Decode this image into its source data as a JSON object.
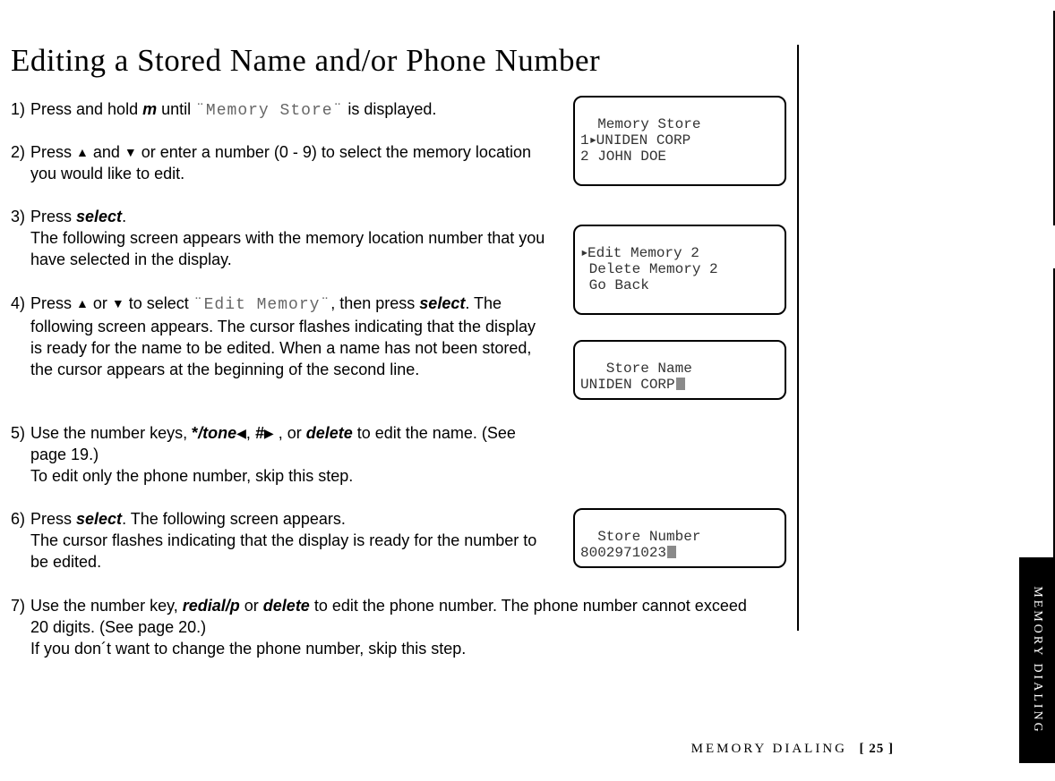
{
  "title": "Editing a Stored Name and/or Phone Number",
  "steps": {
    "s1_a": "Press and hold ",
    "s1_key": "m",
    "s1_b": " until ",
    "s1_lcd": "¨Memory Store¨",
    "s1_c": " is displayed.",
    "s2_a": "Press ",
    "s2_b": " and ",
    "s2_c": " or enter a number (0 - 9) to select the memory location you would like to edit.",
    "s3_a": "Press ",
    "s3_key": "select",
    "s3_b": ".",
    "s3_c": "The following screen appears with the memory location number that you have selected in the display.",
    "s4_a": "Press ",
    "s4_b": " or ",
    "s4_c": " to select ",
    "s4_lcd": "¨Edit Memory¨",
    "s4_d": ", then press ",
    "s4_key": "select",
    "s4_e": ". The following screen appears. The cursor flashes indicating that the display is ready for the name to be edited. When a name has not been stored, the cursor appears at the beginning of the second line.",
    "s5_a": "Use the number keys,  ",
    "s5_star": "*",
    "s5_tone": "/tone",
    "s5_b": ", ",
    "s5_hash": "#",
    "s5_c": " , or ",
    "s5_del": "delete",
    "s5_d": " to edit the name. (See page 19.)",
    "s5_e": "To edit only the phone number, skip this step.",
    "s6_a": "Press ",
    "s6_key": "select",
    "s6_b": ". The following screen appears.",
    "s6_c": "The cursor flashes indicating that the display is ready for the number to be edited.",
    "s7_a": "Use the number key, ",
    "s7_redial": "redial/p",
    "s7_b": " or ",
    "s7_del": "delete",
    "s7_c": " to edit the phone number. The phone number cannot exceed 20 digits. (See page 20.)",
    "s7_d": "If you don´t want to change the phone number, skip this step."
  },
  "lcd": {
    "box1_l1": "  Memory Store",
    "box1_l2": "1 UNIDEN CORP",
    "box1_l3": "2 JOHN DOE",
    "box2_l1": " Edit Memory 2",
    "box2_l2": " Delete Memory 2",
    "box2_l3": " Go Back",
    "box3_l1": "   Store Name",
    "box3_l2": "UNIDEN CORP",
    "box4_l1": "  Store Number",
    "box4_l2": "8002971023"
  },
  "footer": {
    "section": "MEMORY DIALING",
    "page": "[ 25 ]",
    "tab": "MEMORY DIALING"
  }
}
